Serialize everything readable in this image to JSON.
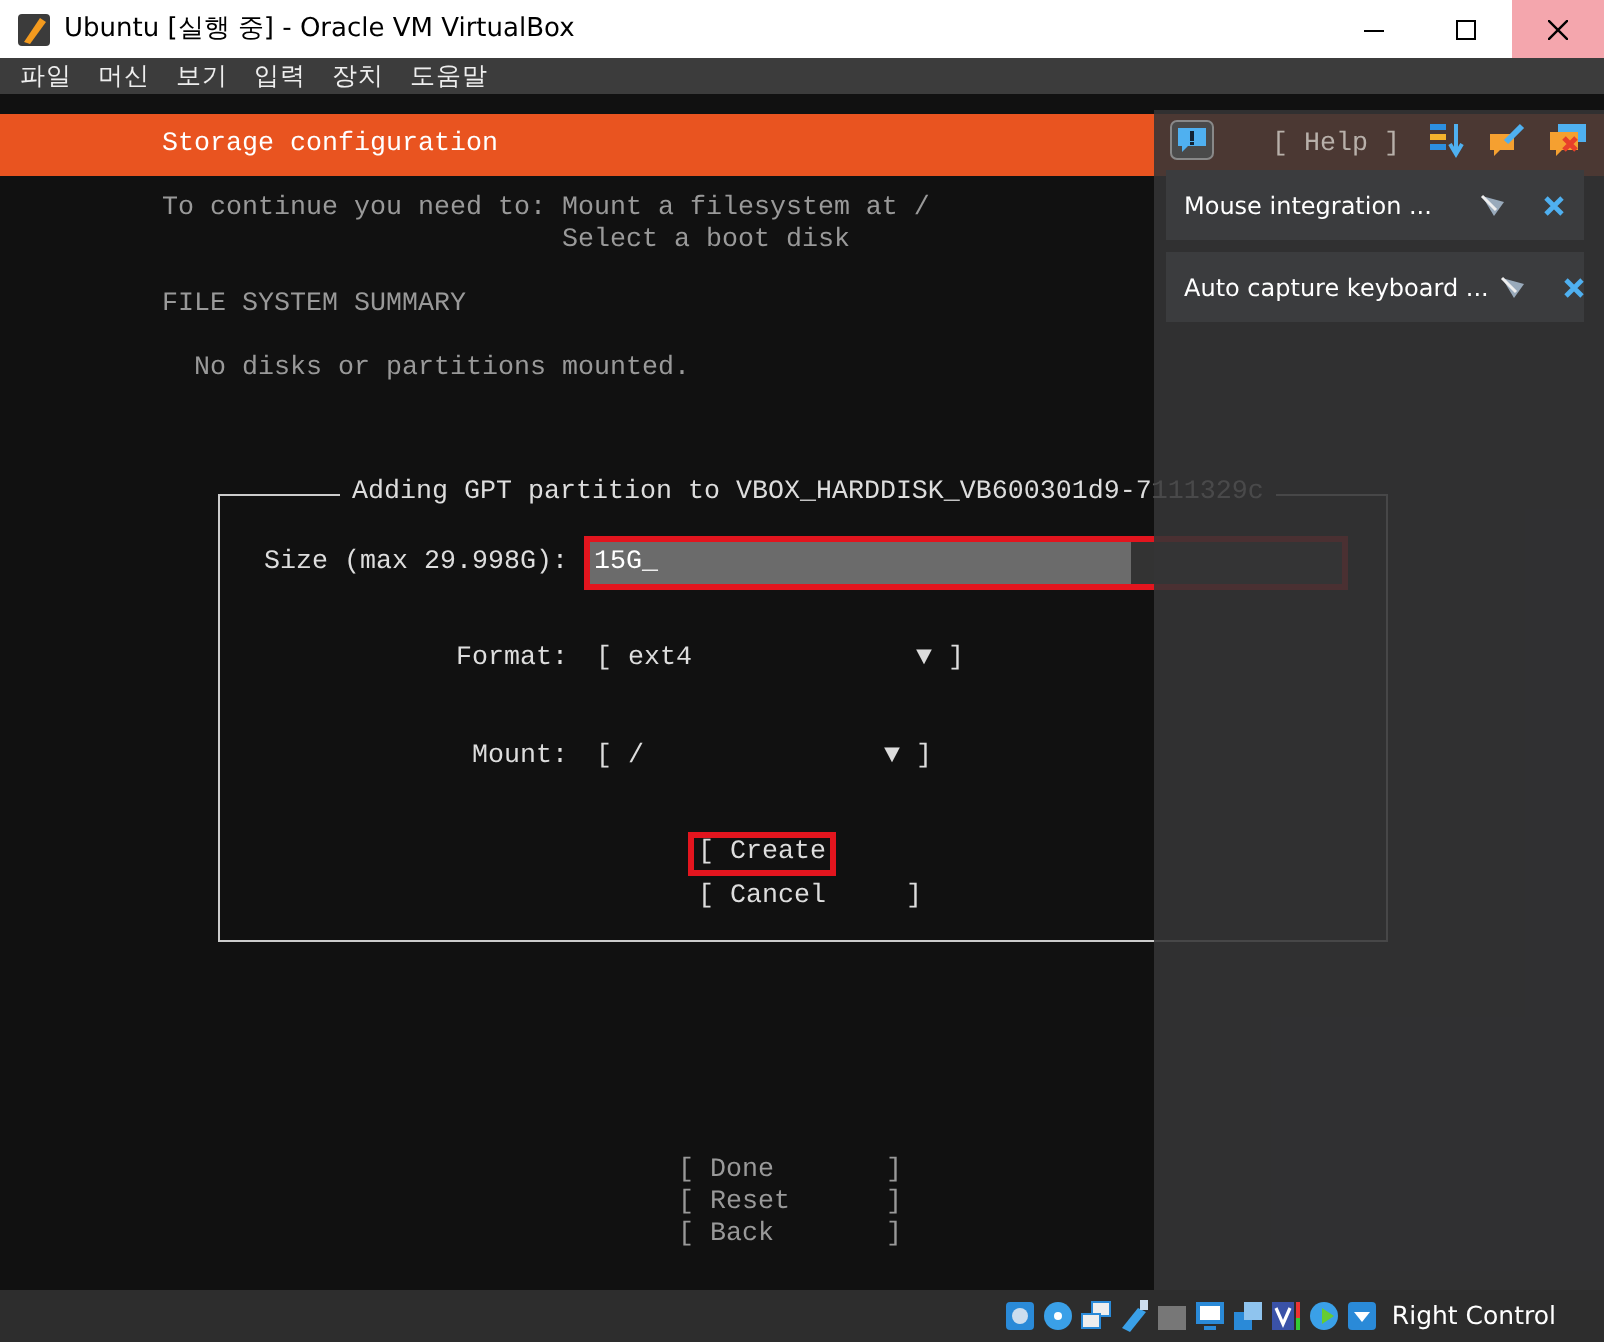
{
  "window": {
    "title": "Ubuntu [실행 중] - Oracle VM VirtualBox"
  },
  "menu": [
    "파일",
    "머신",
    "보기",
    "입력",
    "장치",
    "도움말"
  ],
  "installer": {
    "header": "Storage configuration",
    "help": "[ Help ]",
    "requirements_label": "To continue you need to:",
    "requirements": [
      "Mount a filesystem at /",
      "Select a boot disk"
    ],
    "summary_heading": "FILE SYSTEM SUMMARY",
    "summary_text": "No disks or partitions mounted.",
    "dialog": {
      "title": "Adding GPT partition to VBOX_HARDDISK_VB600301d9-7111329c",
      "fields": [
        {
          "kind": "text",
          "label": "Size (max 29.998G):",
          "value": "15G_",
          "highlighted": true
        },
        {
          "kind": "select",
          "label": "Format:",
          "value": "[ ext4              ▼ ]"
        },
        {
          "kind": "select",
          "label": "Mount:",
          "value": "[ /               ▼ ]"
        }
      ],
      "buttons": [
        {
          "label": "[ Create",
          "highlighted": true
        },
        {
          "label": "[ Cancel     ]",
          "highlighted": false
        }
      ]
    },
    "footer_buttons": [
      "[ Done       ]",
      "[ Reset      ]",
      "[ Back       ]"
    ]
  },
  "notifications": [
    {
      "text": "Mouse integration ..."
    },
    {
      "text": "Auto capture keyboard ..."
    }
  ],
  "status_bar": {
    "host_key": "Right Control"
  }
}
